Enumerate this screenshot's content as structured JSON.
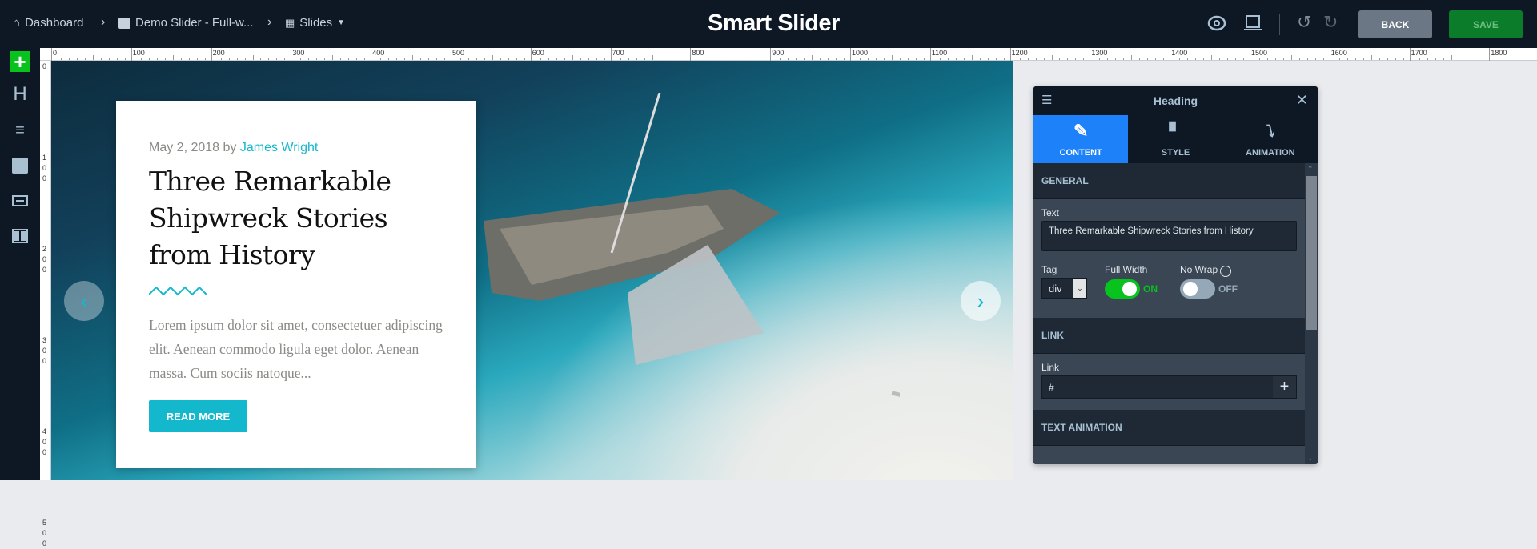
{
  "topbar": {
    "breadcrumbs": [
      {
        "label": "Dashboard",
        "icon": "home-icon"
      },
      {
        "label": "Demo Slider - Full-w...",
        "icon": "image-icon"
      },
      {
        "label": "Slides",
        "icon": "grid-icon"
      }
    ],
    "logo": "Smart Slider",
    "back_label": "BACK",
    "save_label": "SAVE"
  },
  "ruler": {
    "top": [
      "0",
      "100",
      "200",
      "300",
      "400",
      "500",
      "600",
      "700",
      "800",
      "900",
      "1000",
      "1100",
      "1200",
      "1300",
      "1400",
      "1500",
      "1600",
      "1700",
      "1800"
    ],
    "left": [
      "0",
      "100",
      "200",
      "300",
      "400",
      "500"
    ]
  },
  "slide": {
    "date": "May 2, 2018 by ",
    "author": "James Wright",
    "title": "Three Remarkable Shipwreck Stories from History",
    "body": "Lorem ipsum dolor sit amet, consectetuer adipiscing elit. Aenean commodo ligula eget dolor. Aenean massa. Cum sociis natoque...",
    "button": "READ MORE"
  },
  "panel": {
    "title": "Heading",
    "tabs": [
      {
        "label": "CONTENT"
      },
      {
        "label": "STYLE"
      },
      {
        "label": "ANIMATION"
      }
    ],
    "general": "GENERAL",
    "text_label": "Text",
    "text_value": "Three Remarkable Shipwreck Stories from History",
    "tag_label": "Tag",
    "tag_value": "div",
    "fullwidth_label": "Full Width",
    "fullwidth_state": "ON",
    "nowrap_label": "No Wrap",
    "nowrap_state": "OFF",
    "link_section": "LINK",
    "link_label": "Link",
    "link_value": "#",
    "text_animation": "TEXT ANIMATION"
  },
  "colors": {
    "accent": "#1d81f9",
    "save": "#0a7c2a",
    "toggle_on": "#08c21e",
    "teal": "#14b8cc"
  }
}
